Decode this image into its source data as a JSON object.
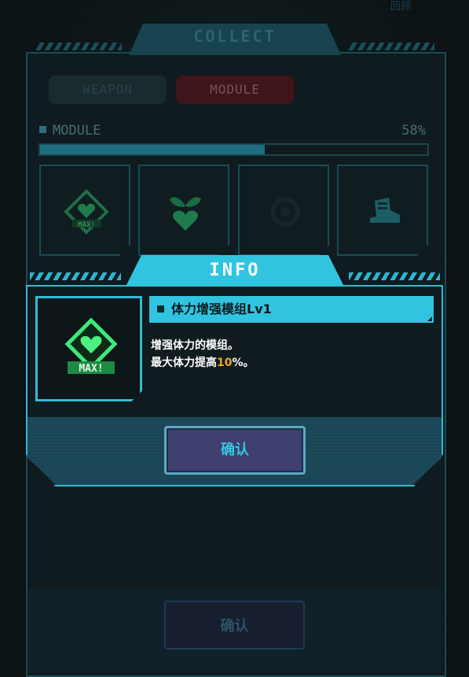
{
  "corner_label": "回顾",
  "collect": {
    "title": "COLLECT",
    "tabs": [
      {
        "label": "WEAPON",
        "active": false
      },
      {
        "label": "MODULE",
        "active": true
      }
    ],
    "section_title": "MODULE",
    "progress_text": "58%",
    "progress": 0.58,
    "slots": [
      {
        "icon": "heart-max-diamond-icon"
      },
      {
        "icon": "heart-leaves-icon"
      },
      {
        "icon": "locked-gear-icon"
      },
      {
        "icon": "boot-icon"
      }
    ],
    "confirm_label": "确认"
  },
  "info_dialog": {
    "title": "INFO",
    "item_icon": "heart-max-diamond-icon",
    "item_icon_text": "MAX!",
    "item_name": "体力增强模组Lv1",
    "desc_line1": "增强体力的模组。",
    "desc_line2_prefix": "最大体力提高",
    "desc_line2_value": "10",
    "desc_line2_suffix": "%。",
    "confirm_label": "确认"
  },
  "colors": {
    "accent_cyan": "#31c4e0",
    "highlight_orange": "#f3a51d",
    "confirm_button_bg": "#3e3f6e"
  }
}
